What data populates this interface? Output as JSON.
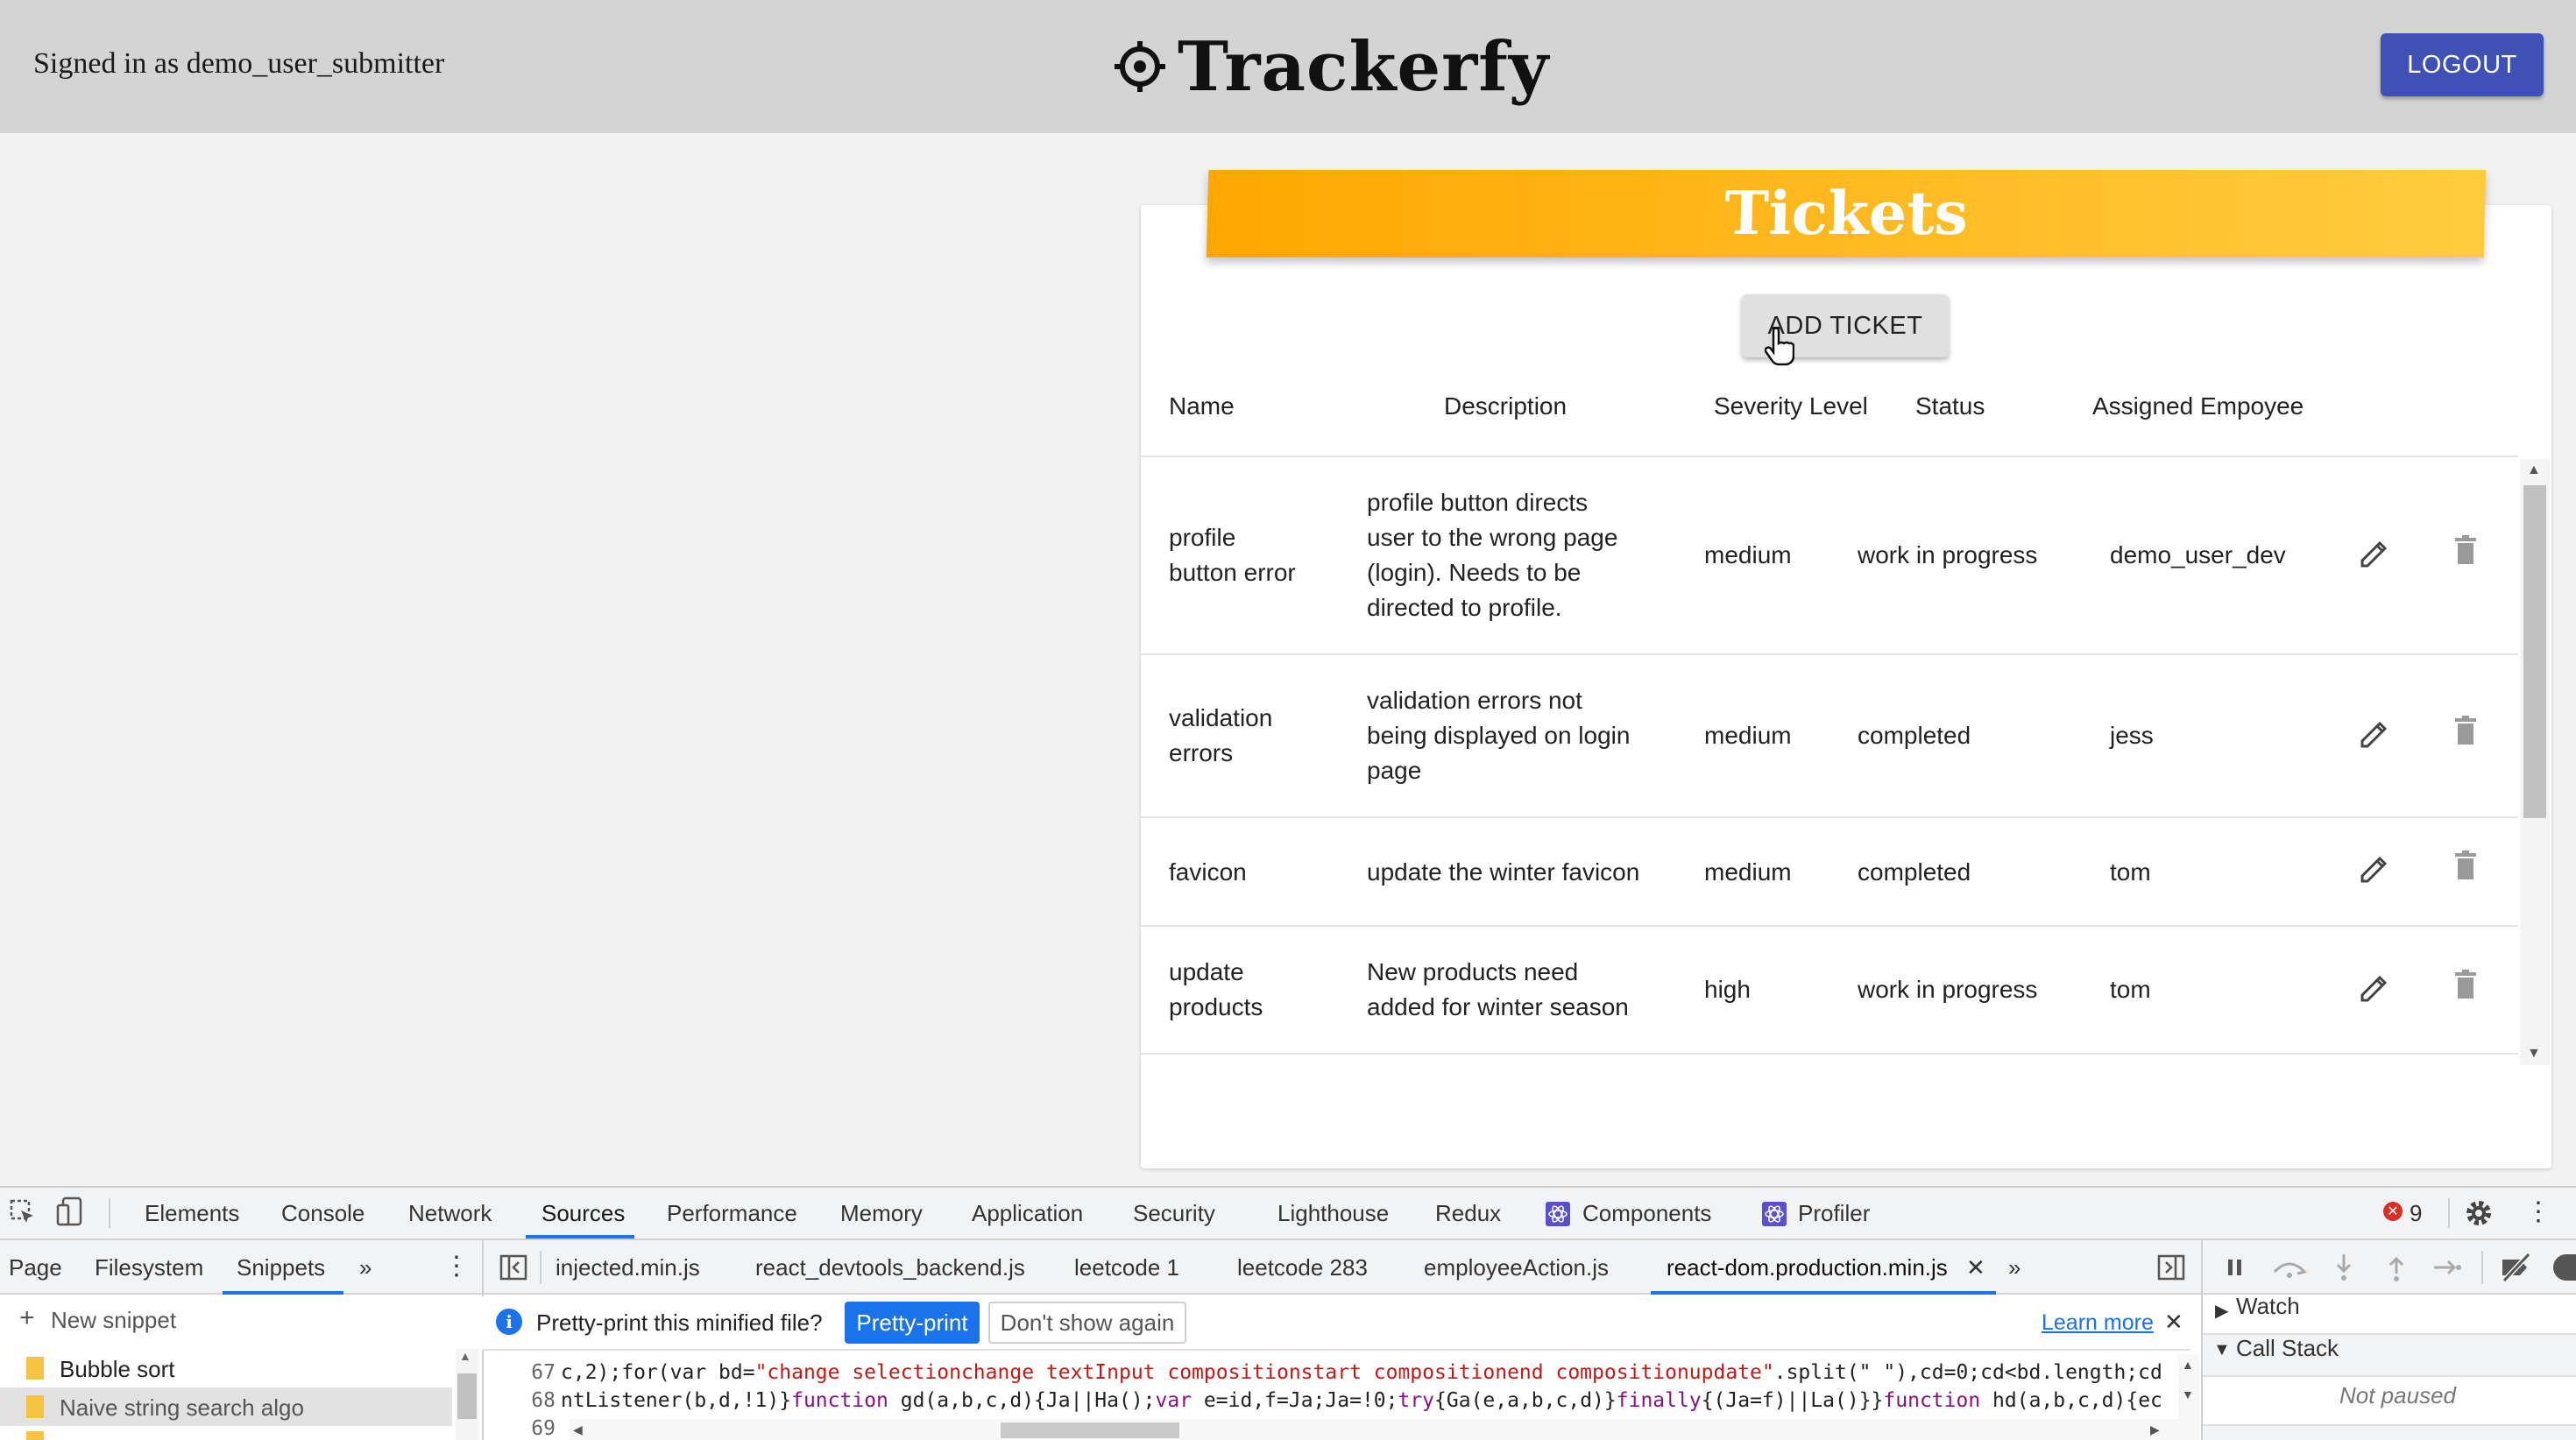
{
  "header": {
    "signed_in": "Signed in as demo_user_submitter",
    "brand": "Trackerfy",
    "logout_label": "LOGOUT"
  },
  "tickets": {
    "title": "Tickets",
    "add_label": "ADD TICKET",
    "columns": [
      "Name",
      "Description",
      "Severity Level",
      "Status",
      "Assigned Empoyee"
    ],
    "rows": [
      {
        "name": [
          "profile",
          "button error"
        ],
        "description": [
          "profile button directs",
          "user to the wrong page",
          "(login). Needs to be",
          "directed to profile."
        ],
        "severity": "medium",
        "status": "work in progress",
        "assignee": "demo_user_dev"
      },
      {
        "name": [
          "validation",
          "errors"
        ],
        "description": [
          "validation errors not",
          "being displayed on login",
          "page"
        ],
        "severity": "medium",
        "status": "completed",
        "assignee": "jess"
      },
      {
        "name": [
          "favicon"
        ],
        "description": [
          "update the winter favicon"
        ],
        "severity": "medium",
        "status": "completed",
        "assignee": "tom"
      },
      {
        "name": [
          "update",
          "products"
        ],
        "description": [
          "New products need",
          "added for winter season"
        ],
        "severity": "high",
        "status": "work in progress",
        "assignee": "tom"
      }
    ]
  },
  "devtools": {
    "tabs": [
      "Elements",
      "Console",
      "Network",
      "Sources",
      "Performance",
      "Memory",
      "Application",
      "Security",
      "Lighthouse",
      "Redux",
      "Components",
      "Profiler"
    ],
    "active_tab": "Sources",
    "error_count": "9",
    "nav_tabs": [
      "Page",
      "Filesystem",
      "Snippets"
    ],
    "new_snippet": "New snippet",
    "snippets": [
      "Bubble sort",
      "Naive string search algo"
    ],
    "file_tabs": [
      "injected.min.js",
      "react_devtools_backend.js",
      "leetcode 1",
      "leetcode 283",
      "employeeAction.js",
      "react-dom.production.min.js"
    ],
    "notice": "Pretty-print this minified file?",
    "pretty_print": "Pretty-print",
    "dont_show": "Don't show again",
    "learn_more": "Learn more",
    "code_lines": [
      {
        "no": "67",
        "text": "c,2);for(var bd=\"change selectionchange textInput compositionstart compositionend compositionupdate\".split(\" \"),cd=0;cd<bd.length;cd"
      },
      {
        "no": "68",
        "text": "ntListener(b,d,!1)}function gd(a,b,c,d){Ja||Ha();var e=id,f=Ja;Ja=!0;try{Ga(e,a,b,c,d)}finally{(Ja=f)||La()}}function hd(a,b,c,d){ec"
      },
      {
        "no": "69",
        "text": ""
      }
    ],
    "watch": "Watch",
    "call_stack": "Call Stack",
    "not_paused": "Not paused"
  }
}
